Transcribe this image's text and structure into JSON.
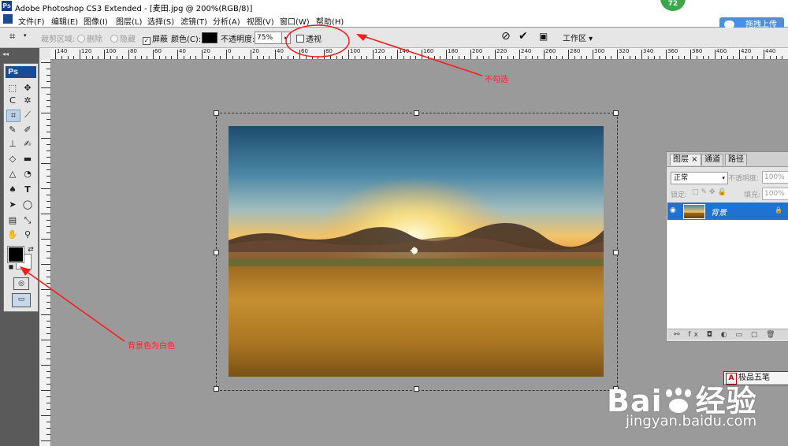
{
  "window": {
    "title": "Adobe Photoshop CS3 Extended - [麦田.jpg @ 200%(RGB/8)]",
    "app_icon": "Ps",
    "badge": "72"
  },
  "menu": [
    "文件(F)",
    "编辑(E)",
    "图像(I)",
    "图层(L)",
    "选择(S)",
    "滤镜(T)",
    "分析(A)",
    "视图(V)",
    "窗口(W)",
    "帮助(H)"
  ],
  "upload_button": "拖拽上传",
  "options": {
    "crop_area_label": "裁剪区域:",
    "delete_label": "删除",
    "hide_label": "隐藏",
    "shield_label": "屏蔽",
    "color_label": "颜色(C):",
    "opacity_label": "不透明度:",
    "opacity_value": "75%",
    "perspective_label": "透视",
    "workspace_label": "工作区 ▾",
    "shield_color": "#000000"
  },
  "ruler_top": [
    "140",
    "120",
    "100",
    "80",
    "60",
    "40",
    "20",
    "0",
    "20",
    "40",
    "60",
    "80",
    "100",
    "120",
    "140",
    "160",
    "180",
    "200",
    "220",
    "240",
    "260",
    "280",
    "300",
    "320",
    "340",
    "360",
    "380",
    "400",
    "420",
    "440"
  ],
  "toolbox": {
    "logo": "Ps"
  },
  "annotations": {
    "top": "不勾选",
    "left": "背景色为白色"
  },
  "layers_panel": {
    "tabs": [
      "图层 ×",
      "通道",
      "路径"
    ],
    "blend_mode": "正常",
    "opacity_label": "不透明度:",
    "opacity_value": "100%",
    "lock_label": "锁定:",
    "fill_label": "填充:",
    "fill_value": "100%",
    "layer_name": "背景",
    "footer_icons": "⚯ fx ◘ ◐ ▭ ▢ 🗑"
  },
  "ime": {
    "letter": "A",
    "label": "极品五笔"
  },
  "watermark": {
    "brand": "Bai",
    "brand2": "经验",
    "url": "jingyan.baidu.com"
  }
}
